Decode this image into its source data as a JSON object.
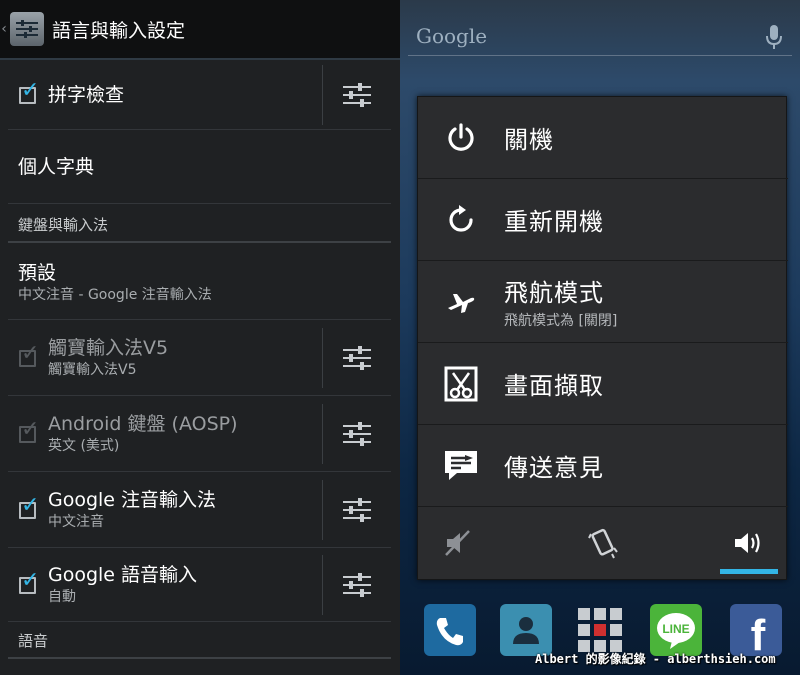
{
  "settings": {
    "title": "語言與輸入設定",
    "spell_check": {
      "label": "拼字檢查",
      "checked": true
    },
    "personal_dictionary": "個人字典",
    "section_keyboard": "鍵盤與輸入法",
    "default": {
      "label": "預設",
      "value": "中文注音 - Google 注音輸入法"
    },
    "input_methods": [
      {
        "label": "觸寶輸入法V5",
        "summary": "觸寶輸入法V5",
        "checked": true,
        "enabled": false
      },
      {
        "label": "Android 鍵盤 (AOSP)",
        "summary": "英文 (美式)",
        "checked": true,
        "enabled": false
      },
      {
        "label": "Google 注音輸入法",
        "summary": "中文注音",
        "checked": true,
        "enabled": true
      },
      {
        "label": "Google 語音輸入",
        "summary": "自動",
        "checked": true,
        "enabled": true
      }
    ],
    "section_speech": "語音"
  },
  "home": {
    "search_label": "Google"
  },
  "power_menu": {
    "items": [
      {
        "label": "關機",
        "icon": "power-icon"
      },
      {
        "label": "重新開機",
        "icon": "reboot-icon"
      },
      {
        "label": "飛航模式",
        "sublabel": "飛航模式為 [關閉]",
        "icon": "airplane-icon"
      },
      {
        "label": "畫面擷取",
        "icon": "screenshot-icon"
      },
      {
        "label": "傳送意見",
        "icon": "feedback-icon"
      }
    ],
    "sound_modes": [
      "silent",
      "vibrate",
      "sound"
    ],
    "selected_sound_mode": "sound",
    "accent_color": "#33b5e5"
  },
  "watermark": "Albert 的影像紀錄 - alberthsieh.com"
}
